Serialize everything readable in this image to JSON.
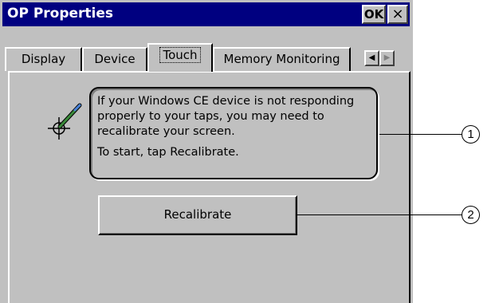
{
  "window": {
    "title": "OP Properties",
    "ok_label": "OK",
    "close_label": "×"
  },
  "tabs": [
    {
      "label": "Display",
      "active": false
    },
    {
      "label": "Device",
      "active": false
    },
    {
      "label": "Touch",
      "active": true
    },
    {
      "label": "Memory Monitoring",
      "active": false
    }
  ],
  "touch_panel": {
    "icon": "stylus-crosshair-icon",
    "info_line1": "If your Windows CE device is not responding properly to your taps, you may need to recalibrate your screen.",
    "info_line2": "To start, tap Recalibrate.",
    "recalibrate_label": "Recalibrate"
  },
  "callouts": [
    "1",
    "2"
  ],
  "colors": {
    "title_bar": "#000080",
    "face": "#c0c0c0",
    "highlight": "#ffffff",
    "shadow": "#808080"
  }
}
